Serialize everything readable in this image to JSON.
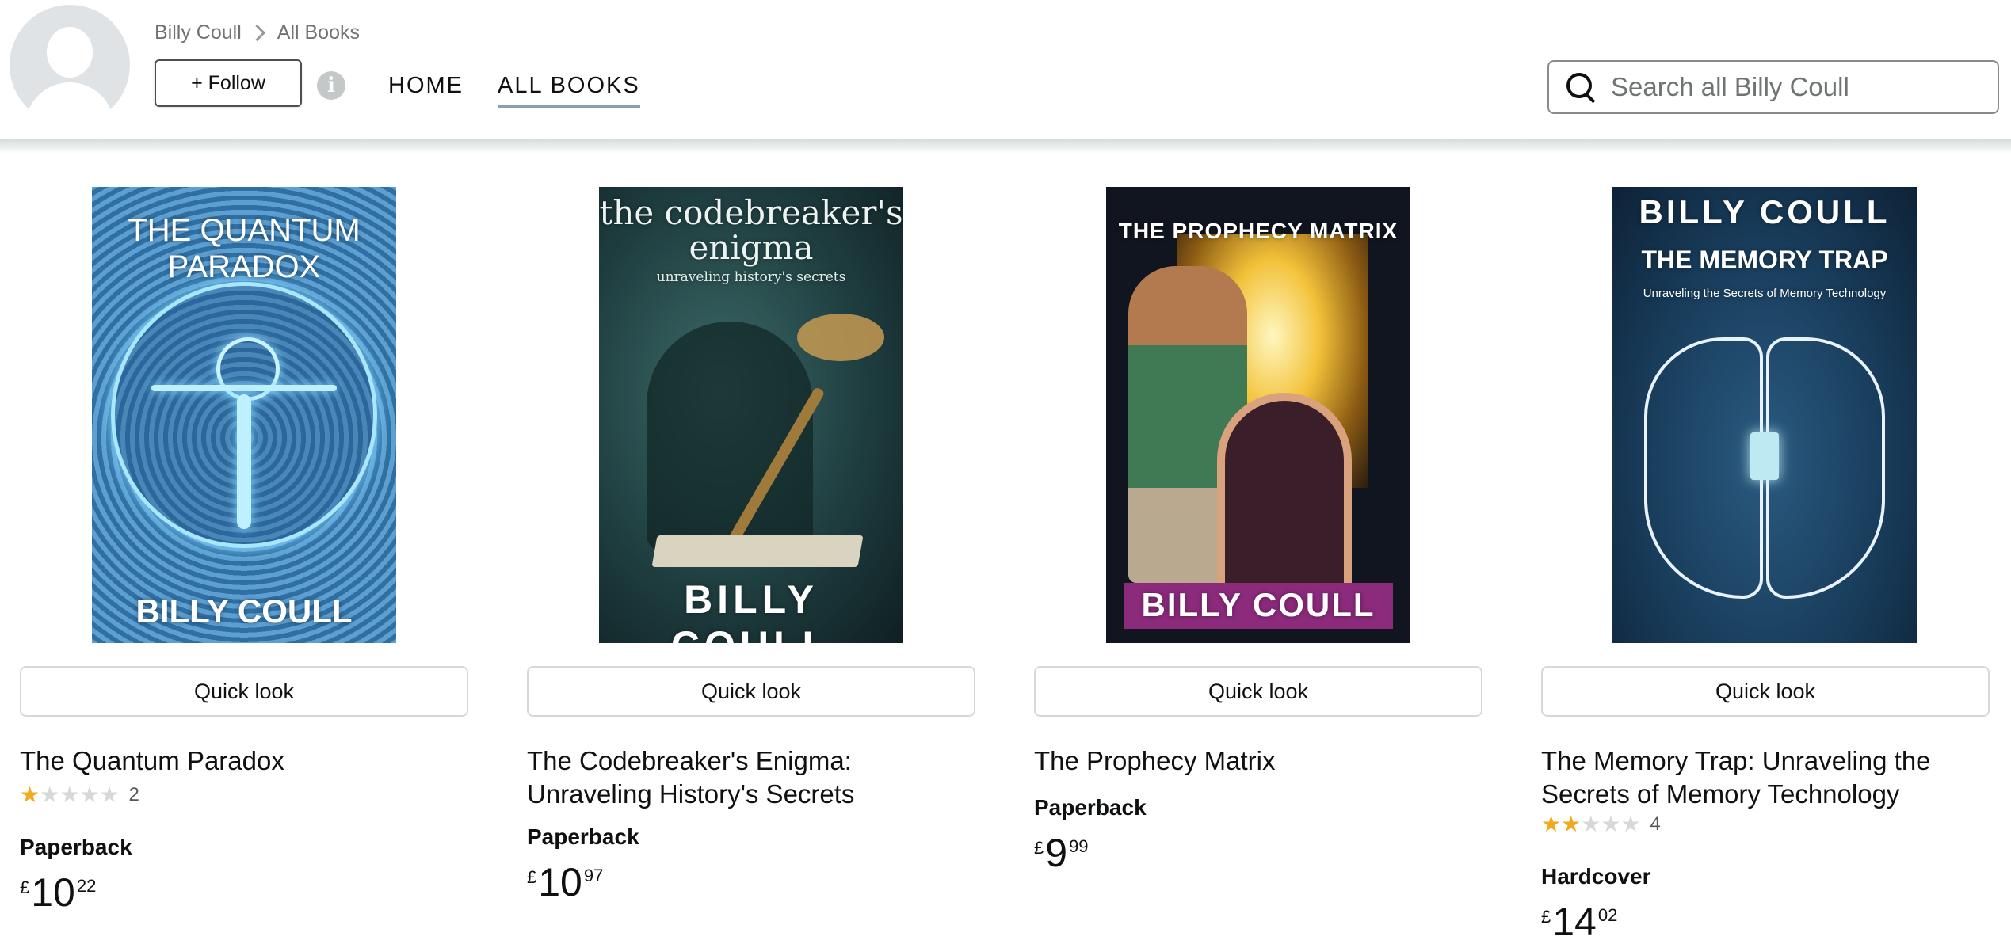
{
  "header": {
    "breadcrumb": [
      "Billy Coull",
      "All Books"
    ],
    "follow_label": "+ Follow",
    "nav_tabs": [
      "HOME",
      "ALL BOOKS"
    ],
    "active_tab": "ALL BOOKS",
    "search_placeholder": "Search all Billy Coull"
  },
  "books": [
    {
      "cover_lines": [
        "THE QUANTUM",
        "PARADOX",
        "BILLY COULL"
      ],
      "quick_look": "Quick look",
      "title": "The Quantum Paradox",
      "rating_stars": 1,
      "rating_count": "2",
      "format": "Paperback",
      "price_symbol": "£",
      "price_whole": "10",
      "price_fraction": "22"
    },
    {
      "cover_lines": [
        "the codebreaker's",
        "enigma",
        "unraveling history's secrets",
        "BILLY COULL"
      ],
      "quick_look": "Quick look",
      "title": "The Codebreaker's Enigma: Unraveling History's Secrets",
      "format": "Paperback",
      "price_symbol": "£",
      "price_whole": "10",
      "price_fraction": "97"
    },
    {
      "cover_lines": [
        "THE PROPHECY MATRIX",
        "BILLY COULL"
      ],
      "quick_look": "Quick look",
      "title": "The Prophecy Matrix",
      "format": "Paperback",
      "price_symbol": "£",
      "price_whole": "9",
      "price_fraction": "99"
    },
    {
      "cover_lines": [
        "BILLY COULL",
        "THE MEMORY TRAP",
        "Unraveling the Secrets of Memory Technology"
      ],
      "quick_look": "Quick look",
      "title": "The Memory Trap: Unraveling the Secrets of Memory Technology",
      "rating_stars": 2,
      "rating_count": "4",
      "format": "Hardcover",
      "price_symbol": "£",
      "price_whole": "14",
      "price_fraction": "02"
    }
  ],
  "colors": {
    "star_filled": "#f2a91d",
    "star_empty": "#d8d8d8",
    "tab_underline": "#8aa0a8",
    "cover3_band": "#8c2a7c"
  },
  "icons": [
    "avatar-placeholder",
    "chevron-right-icon",
    "info-icon",
    "search-icon",
    "star-icon"
  ]
}
